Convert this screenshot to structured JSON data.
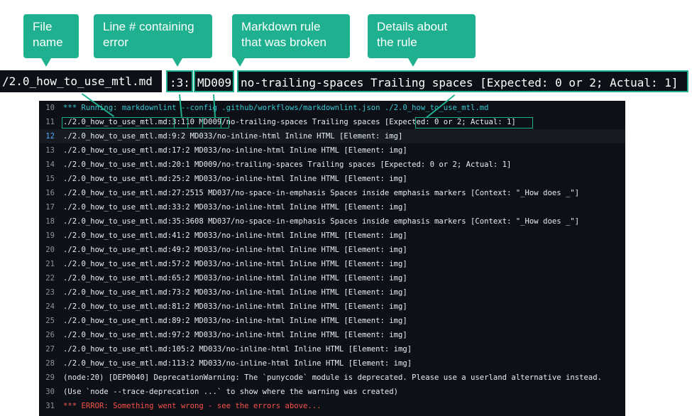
{
  "callouts": [
    {
      "id": "file",
      "text": "File name"
    },
    {
      "id": "line",
      "text": "Line # containing error"
    },
    {
      "id": "rule",
      "text": "Markdown rule that was broken"
    },
    {
      "id": "details",
      "text": "Details about the rule"
    }
  ],
  "zoom": {
    "file": "/2.0_how_to_use_mtl.md",
    "line": ":3:",
    "rule": "MD009",
    "details": "no-trailing-spaces Trailing spaces [Expected: 0 or 2; Actual: 1]"
  },
  "log": [
    {
      "n": "10",
      "text": "*** Running: markdownlint --config .github/workflows/markdownlint.json ./2.0_how_to_use_mtl.md",
      "kind": "cmd"
    },
    {
      "n": "11",
      "text": "./2.0_how_to_use_mtl.md:3:110 MD009/no-trailing-spaces Trailing spaces [Expected: 0 or 2; Actual: 1]",
      "kind": "normal"
    },
    {
      "n": "12",
      "text": "./2.0_how_to_use_mtl.md:9:2 MD033/no-inline-html Inline HTML [Element: img]",
      "kind": "highlight"
    },
    {
      "n": "13",
      "text": "./2.0_how_to_use_mtl.md:17:2 MD033/no-inline-html Inline HTML [Element: img]",
      "kind": "normal"
    },
    {
      "n": "14",
      "text": "./2.0_how_to_use_mtl.md:20:1 MD009/no-trailing-spaces Trailing spaces [Expected: 0 or 2; Actual: 1]",
      "kind": "normal"
    },
    {
      "n": "15",
      "text": "./2.0_how_to_use_mtl.md:25:2 MD033/no-inline-html Inline HTML [Element: img]",
      "kind": "normal"
    },
    {
      "n": "16",
      "text": "./2.0_how_to_use_mtl.md:27:2515 MD037/no-space-in-emphasis Spaces inside emphasis markers [Context: \"_How does _\"]",
      "kind": "normal"
    },
    {
      "n": "17",
      "text": "./2.0_how_to_use_mtl.md:33:2 MD033/no-inline-html Inline HTML [Element: img]",
      "kind": "normal"
    },
    {
      "n": "18",
      "text": "./2.0_how_to_use_mtl.md:35:3608 MD037/no-space-in-emphasis Spaces inside emphasis markers [Context: \"_How does _\"]",
      "kind": "normal"
    },
    {
      "n": "19",
      "text": "./2.0_how_to_use_mtl.md:41:2 MD033/no-inline-html Inline HTML [Element: img]",
      "kind": "normal"
    },
    {
      "n": "20",
      "text": "./2.0_how_to_use_mtl.md:49:2 MD033/no-inline-html Inline HTML [Element: img]",
      "kind": "normal"
    },
    {
      "n": "21",
      "text": "./2.0_how_to_use_mtl.md:57:2 MD033/no-inline-html Inline HTML [Element: img]",
      "kind": "normal"
    },
    {
      "n": "22",
      "text": "./2.0_how_to_use_mtl.md:65:2 MD033/no-inline-html Inline HTML [Element: img]",
      "kind": "normal"
    },
    {
      "n": "23",
      "text": "./2.0_how_to_use_mtl.md:73:2 MD033/no-inline-html Inline HTML [Element: img]",
      "kind": "normal"
    },
    {
      "n": "24",
      "text": "./2.0_how_to_use_mtl.md:81:2 MD033/no-inline-html Inline HTML [Element: img]",
      "kind": "normal"
    },
    {
      "n": "25",
      "text": "./2.0_how_to_use_mtl.md:89:2 MD033/no-inline-html Inline HTML [Element: img]",
      "kind": "normal"
    },
    {
      "n": "26",
      "text": "./2.0_how_to_use_mtl.md:97:2 MD033/no-inline-html Inline HTML [Element: img]",
      "kind": "normal"
    },
    {
      "n": "27",
      "text": "./2.0_how_to_use_mtl.md:105:2 MD033/no-inline-html Inline HTML [Element: img]",
      "kind": "normal"
    },
    {
      "n": "28",
      "text": "./2.0_how_to_use_mtl.md:113:2 MD033/no-inline-html Inline HTML [Element: img]",
      "kind": "normal"
    },
    {
      "n": "29",
      "text": "(node:20) [DEP0040] DeprecationWarning: The `punycode` module is deprecated. Please use a userland alternative instead.",
      "kind": "normal"
    },
    {
      "n": "30",
      "text": "(Use `node --trace-deprecation ...` to show where the warning was created)",
      "kind": "normal"
    },
    {
      "n": "31",
      "text": "*** ERROR: Something went wrong - see the errors above...",
      "kind": "err"
    }
  ],
  "colors": {
    "accent": "#1eb08f",
    "terminal_bg": "#0d1117",
    "error": "#f85149",
    "command": "#39c5cf"
  }
}
